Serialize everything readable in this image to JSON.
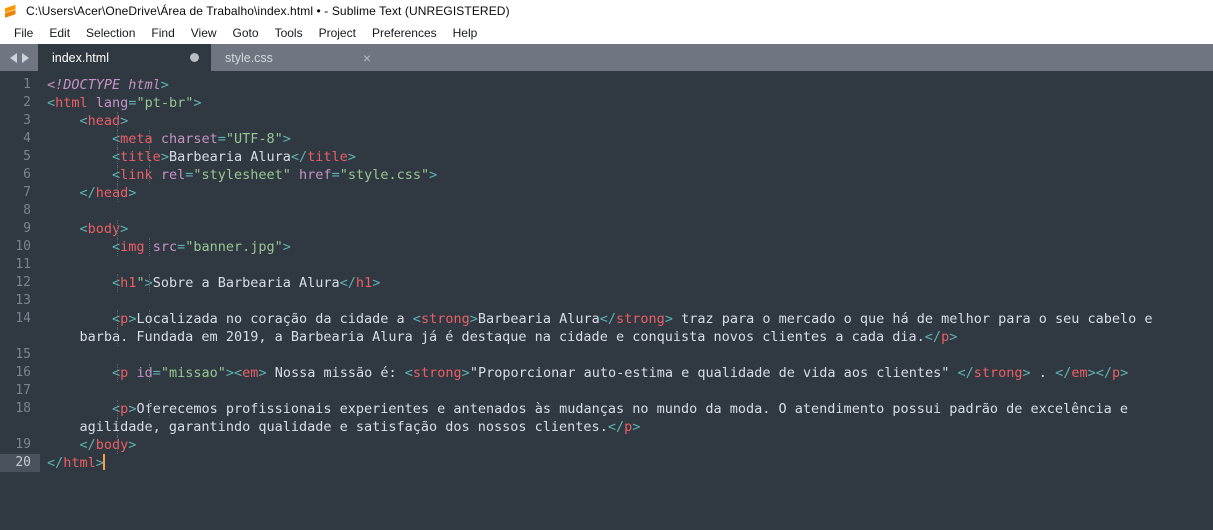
{
  "window": {
    "title": "C:\\Users\\Acer\\OneDrive\\Área de Trabalho\\index.html • - Sublime Text (UNREGISTERED)",
    "app_icon": "sublime-text-logo"
  },
  "menubar": {
    "items": [
      {
        "label": "File"
      },
      {
        "label": "Edit"
      },
      {
        "label": "Selection"
      },
      {
        "label": "Find"
      },
      {
        "label": "View"
      },
      {
        "label": "Goto"
      },
      {
        "label": "Tools"
      },
      {
        "label": "Project"
      },
      {
        "label": "Preferences"
      },
      {
        "label": "Help"
      }
    ]
  },
  "tabbar": {
    "prev_arrow": "prev-tab-arrow",
    "next_arrow": "next-tab-arrow",
    "tabs": [
      {
        "label": "index.html",
        "active": true,
        "dirty": true,
        "marker": ""
      },
      {
        "label": "style.css",
        "active": false,
        "dirty": false,
        "close": "×"
      }
    ]
  },
  "editor": {
    "theme_colors": {
      "background": "#303841",
      "gutter_text": "#7a8491",
      "active_line_gutter_bg": "#4a525d",
      "tag": "#ec5f67",
      "punctuation": "#5fb3b3",
      "attribute": "#c594c5",
      "string": "#99c794",
      "text": "#d8dee9",
      "cursor": "#f9a03f"
    },
    "cursor_line": 20,
    "gutter_numbers": [
      "1",
      "2",
      "3",
      "4",
      "5",
      "6",
      "7",
      "8",
      "9",
      "10",
      "11",
      "12",
      "13",
      "14",
      "",
      "15",
      "16",
      "17",
      "18",
      "",
      "19",
      "20"
    ],
    "lines": [
      {
        "num": "1",
        "indent": 0,
        "tokens": [
          {
            "c": "doct",
            "t": "<!DOCTYPE html"
          },
          {
            "c": "punc",
            "t": ">"
          }
        ]
      },
      {
        "num": "2",
        "indent": 0,
        "tokens": [
          {
            "c": "punc",
            "t": "<"
          },
          {
            "c": "tag",
            "t": "html"
          },
          {
            "c": "txt",
            "t": " "
          },
          {
            "c": "attr",
            "t": "lang"
          },
          {
            "c": "punc",
            "t": "="
          },
          {
            "c": "attrg",
            "t": "\"pt-br\""
          },
          {
            "c": "punc",
            "t": ">"
          }
        ]
      },
      {
        "num": "3",
        "indent": 1,
        "tokens": [
          {
            "c": "punc",
            "t": "<"
          },
          {
            "c": "tag",
            "t": "head"
          },
          {
            "c": "punc",
            "t": ">"
          }
        ]
      },
      {
        "num": "4",
        "indent": 2,
        "tokens": [
          {
            "c": "punc",
            "t": "<"
          },
          {
            "c": "tag",
            "t": "meta"
          },
          {
            "c": "txt",
            "t": " "
          },
          {
            "c": "attr",
            "t": "charset"
          },
          {
            "c": "punc",
            "t": "="
          },
          {
            "c": "attrg",
            "t": "\"UTF-8\""
          },
          {
            "c": "punc",
            "t": ">"
          }
        ]
      },
      {
        "num": "5",
        "indent": 2,
        "tokens": [
          {
            "c": "punc",
            "t": "<"
          },
          {
            "c": "tag",
            "t": "title"
          },
          {
            "c": "punc",
            "t": ">"
          },
          {
            "c": "txt",
            "t": "Barbearia Alura"
          },
          {
            "c": "punc",
            "t": "</"
          },
          {
            "c": "tag",
            "t": "title"
          },
          {
            "c": "punc",
            "t": ">"
          }
        ]
      },
      {
        "num": "6",
        "indent": 2,
        "tokens": [
          {
            "c": "punc",
            "t": "<"
          },
          {
            "c": "tag",
            "t": "link"
          },
          {
            "c": "txt",
            "t": " "
          },
          {
            "c": "attr",
            "t": "rel"
          },
          {
            "c": "punc",
            "t": "="
          },
          {
            "c": "attrg",
            "t": "\"stylesheet\""
          },
          {
            "c": "txt",
            "t": " "
          },
          {
            "c": "attr",
            "t": "href"
          },
          {
            "c": "punc",
            "t": "="
          },
          {
            "c": "attrg",
            "t": "\"style.css\""
          },
          {
            "c": "punc",
            "t": ">"
          }
        ]
      },
      {
        "num": "7",
        "indent": 1,
        "tokens": [
          {
            "c": "punc",
            "t": "</"
          },
          {
            "c": "tag",
            "t": "head"
          },
          {
            "c": "punc",
            "t": ">"
          }
        ]
      },
      {
        "num": "8",
        "indent": 0,
        "tokens": []
      },
      {
        "num": "9",
        "indent": 1,
        "tokens": [
          {
            "c": "punc",
            "t": "<"
          },
          {
            "c": "tag",
            "t": "body"
          },
          {
            "c": "punc",
            "t": ">"
          }
        ]
      },
      {
        "num": "10",
        "indent": 2,
        "tokens": [
          {
            "c": "punc",
            "t": "<"
          },
          {
            "c": "tag",
            "t": "img"
          },
          {
            "c": "txt",
            "t": " "
          },
          {
            "c": "attr",
            "t": "src"
          },
          {
            "c": "punc",
            "t": "="
          },
          {
            "c": "attrg",
            "t": "\"banner.jpg\""
          },
          {
            "c": "punc",
            "t": ">"
          }
        ]
      },
      {
        "num": "11",
        "indent": 0,
        "tokens": []
      },
      {
        "num": "12",
        "indent": 2,
        "tokens": [
          {
            "c": "punc",
            "t": "<"
          },
          {
            "c": "tag",
            "t": "h1"
          },
          {
            "c": "attrg",
            "t": "\""
          },
          {
            "c": "punc",
            "t": ">"
          },
          {
            "c": "txt",
            "t": "Sobre a Barbearia Alura"
          },
          {
            "c": "punc",
            "t": "</"
          },
          {
            "c": "tag",
            "t": "h1"
          },
          {
            "c": "punc",
            "t": ">"
          }
        ]
      },
      {
        "num": "13",
        "indent": 0,
        "tokens": []
      },
      {
        "num": "14",
        "indent": 2,
        "tokens": [
          {
            "c": "punc",
            "t": "<"
          },
          {
            "c": "tag",
            "t": "p"
          },
          {
            "c": "punc",
            "t": ">"
          },
          {
            "c": "txt",
            "t": "Localizada no coração da cidade a "
          },
          {
            "c": "punc",
            "t": "<"
          },
          {
            "c": "tag",
            "t": "strong"
          },
          {
            "c": "punc",
            "t": ">"
          },
          {
            "c": "txt",
            "t": "Barbearia Alura"
          },
          {
            "c": "punc",
            "t": "</"
          },
          {
            "c": "tag",
            "t": "strong"
          },
          {
            "c": "punc",
            "t": ">"
          },
          {
            "c": "txt",
            "t": " traz para o mercado o que há de melhor para o seu cabelo e"
          }
        ]
      },
      {
        "num": "",
        "indent": 1,
        "wrapped": true,
        "tokens": [
          {
            "c": "txt",
            "t": "barba. Fundada em 2019, a Barbearia Alura já é destaque na cidade e conquista novos clientes a cada dia."
          },
          {
            "c": "punc",
            "t": "</"
          },
          {
            "c": "tag",
            "t": "p"
          },
          {
            "c": "punc",
            "t": ">"
          }
        ]
      },
      {
        "num": "15",
        "indent": 0,
        "tokens": []
      },
      {
        "num": "16",
        "indent": 2,
        "tokens": [
          {
            "c": "punc",
            "t": "<"
          },
          {
            "c": "tag",
            "t": "p"
          },
          {
            "c": "txt",
            "t": " "
          },
          {
            "c": "attr",
            "t": "id"
          },
          {
            "c": "punc",
            "t": "="
          },
          {
            "c": "attrg",
            "t": "\"missao\""
          },
          {
            "c": "punc",
            "t": ">"
          },
          {
            "c": "punc",
            "t": "<"
          },
          {
            "c": "tag",
            "t": "em"
          },
          {
            "c": "punc",
            "t": ">"
          },
          {
            "c": "txt",
            "t": " Nossa missão é: "
          },
          {
            "c": "punc",
            "t": "<"
          },
          {
            "c": "tag",
            "t": "strong"
          },
          {
            "c": "punc",
            "t": ">"
          },
          {
            "c": "txt",
            "t": "\"Proporcionar auto-estima e qualidade de vida aos clientes\" "
          },
          {
            "c": "punc",
            "t": "</"
          },
          {
            "c": "tag",
            "t": "strong"
          },
          {
            "c": "punc",
            "t": ">"
          },
          {
            "c": "txt",
            "t": " . "
          },
          {
            "c": "punc",
            "t": "</"
          },
          {
            "c": "tag",
            "t": "em"
          },
          {
            "c": "punc",
            "t": ">"
          },
          {
            "c": "punc",
            "t": "</"
          },
          {
            "c": "tag",
            "t": "p"
          },
          {
            "c": "punc",
            "t": ">"
          }
        ]
      },
      {
        "num": "17",
        "indent": 0,
        "tokens": []
      },
      {
        "num": "18",
        "indent": 2,
        "tokens": [
          {
            "c": "punc",
            "t": "<"
          },
          {
            "c": "tag",
            "t": "p"
          },
          {
            "c": "punc",
            "t": ">"
          },
          {
            "c": "txt",
            "t": "Oferecemos profissionais experientes e antenados às mudanças no mundo da moda. O atendimento possui padrão de excelência e"
          }
        ]
      },
      {
        "num": "",
        "indent": 1,
        "wrapped": true,
        "tokens": [
          {
            "c": "txt",
            "t": "agilidade, garantindo qualidade e satisfação dos nossos clientes."
          },
          {
            "c": "punc",
            "t": "</"
          },
          {
            "c": "tag",
            "t": "p"
          },
          {
            "c": "punc",
            "t": ">"
          }
        ]
      },
      {
        "num": "19",
        "indent": 1,
        "tokens": [
          {
            "c": "punc",
            "t": "</"
          },
          {
            "c": "tag",
            "t": "body"
          },
          {
            "c": "punc",
            "t": ">"
          }
        ]
      },
      {
        "num": "20",
        "indent": 0,
        "active": true,
        "cursor": true,
        "tokens": [
          {
            "c": "punc",
            "t": "</"
          },
          {
            "c": "tag",
            "t": "html"
          },
          {
            "c": "punc",
            "t": ">"
          }
        ]
      }
    ]
  }
}
